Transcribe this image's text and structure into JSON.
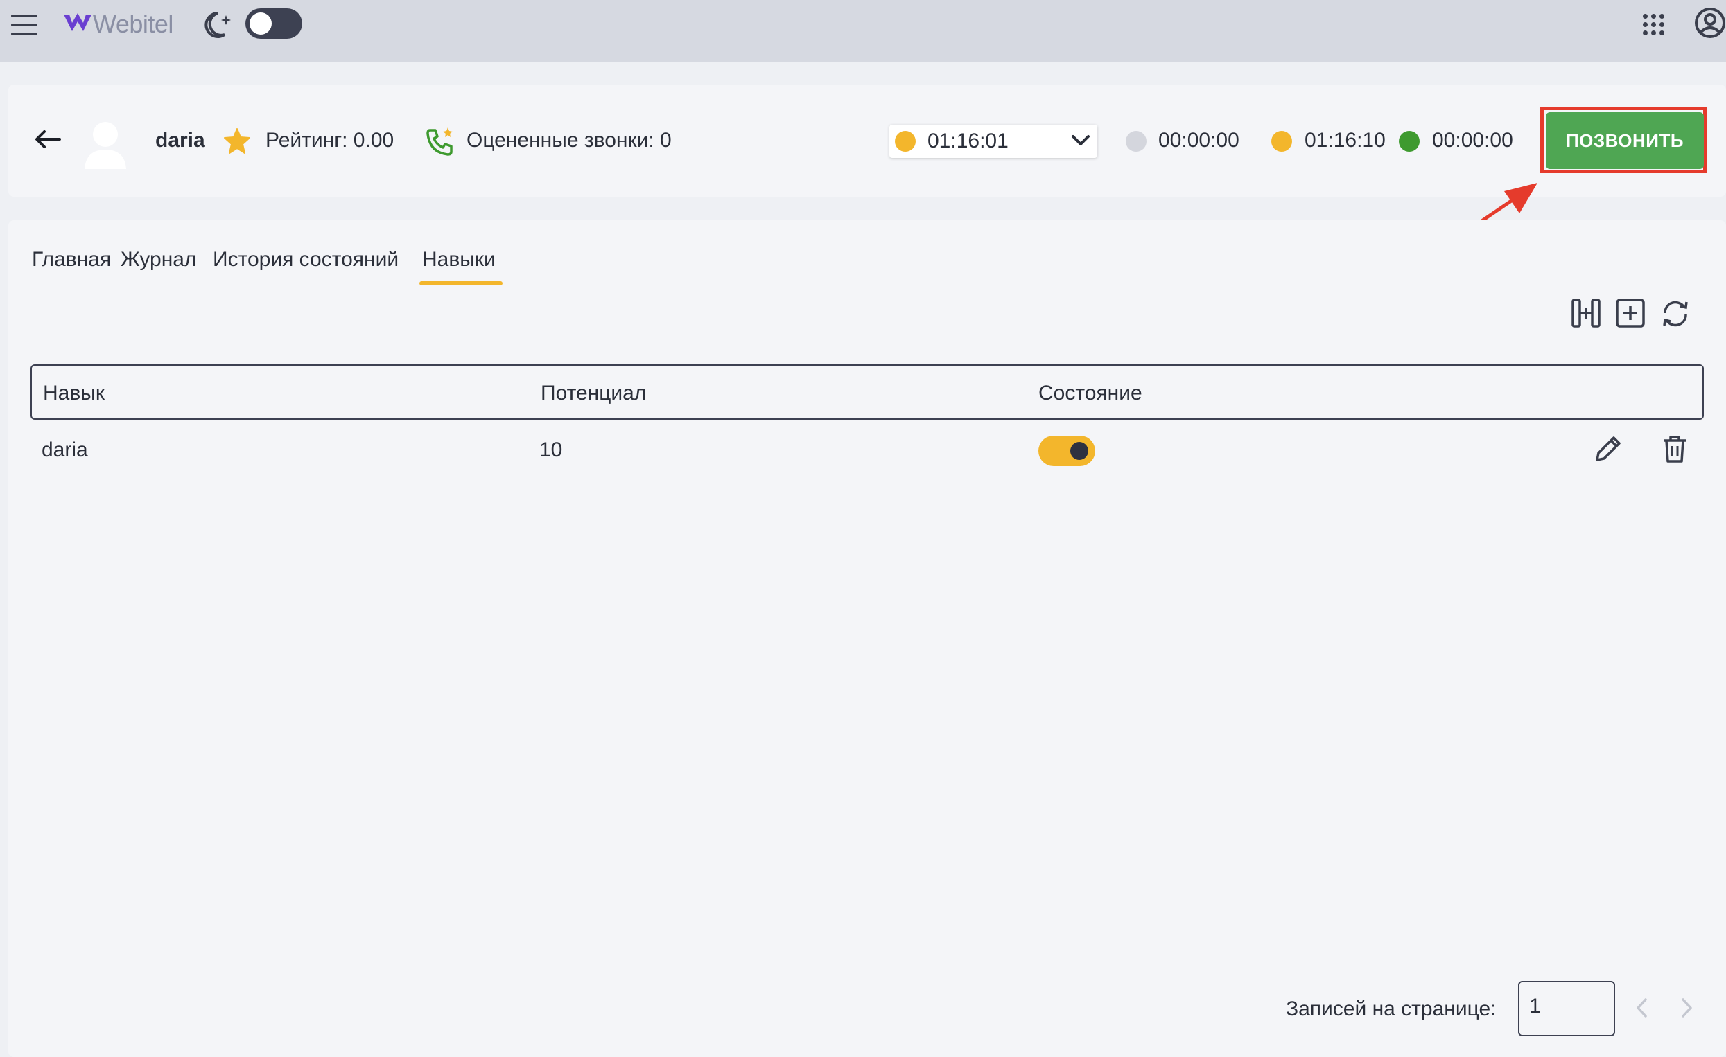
{
  "topbar": {
    "logo_text": "Webitel",
    "icons": [
      "menu-icon",
      "moon-icon",
      "apps-grid-icon",
      "user-account-icon"
    ],
    "theme_toggle": "off"
  },
  "agent": {
    "name": "daria",
    "rating_label": "Рейтинг: 0.00",
    "rated_calls_label": "Оцененные звонки: 0"
  },
  "status": {
    "selected_time": "01:16:01",
    "selected_color": "#f3b62c",
    "timers": [
      {
        "value": "00:00:00",
        "color": "#d4d6dd"
      },
      {
        "value": "01:16:10",
        "color": "#f3b62c"
      },
      {
        "value": "00:00:00",
        "color": "#3e9a2f"
      }
    ],
    "call_button_label": "ПОЗВОНИТЬ",
    "call_button_color": "#4fa653",
    "highlight_color": "#e53b2c"
  },
  "tabs": [
    {
      "label": "Главная",
      "active": false
    },
    {
      "label": "Журнал",
      "active": false
    },
    {
      "label": "История состояний",
      "active": false
    },
    {
      "label": "Навыки",
      "active": true
    }
  ],
  "table": {
    "columns": [
      "Навык",
      "Потенциал",
      "Состояние"
    ],
    "rows": [
      {
        "skill": "daria",
        "potential": "10",
        "state": true
      }
    ]
  },
  "pagination": {
    "label": "Записей на странице:",
    "per_page_value": "1"
  }
}
